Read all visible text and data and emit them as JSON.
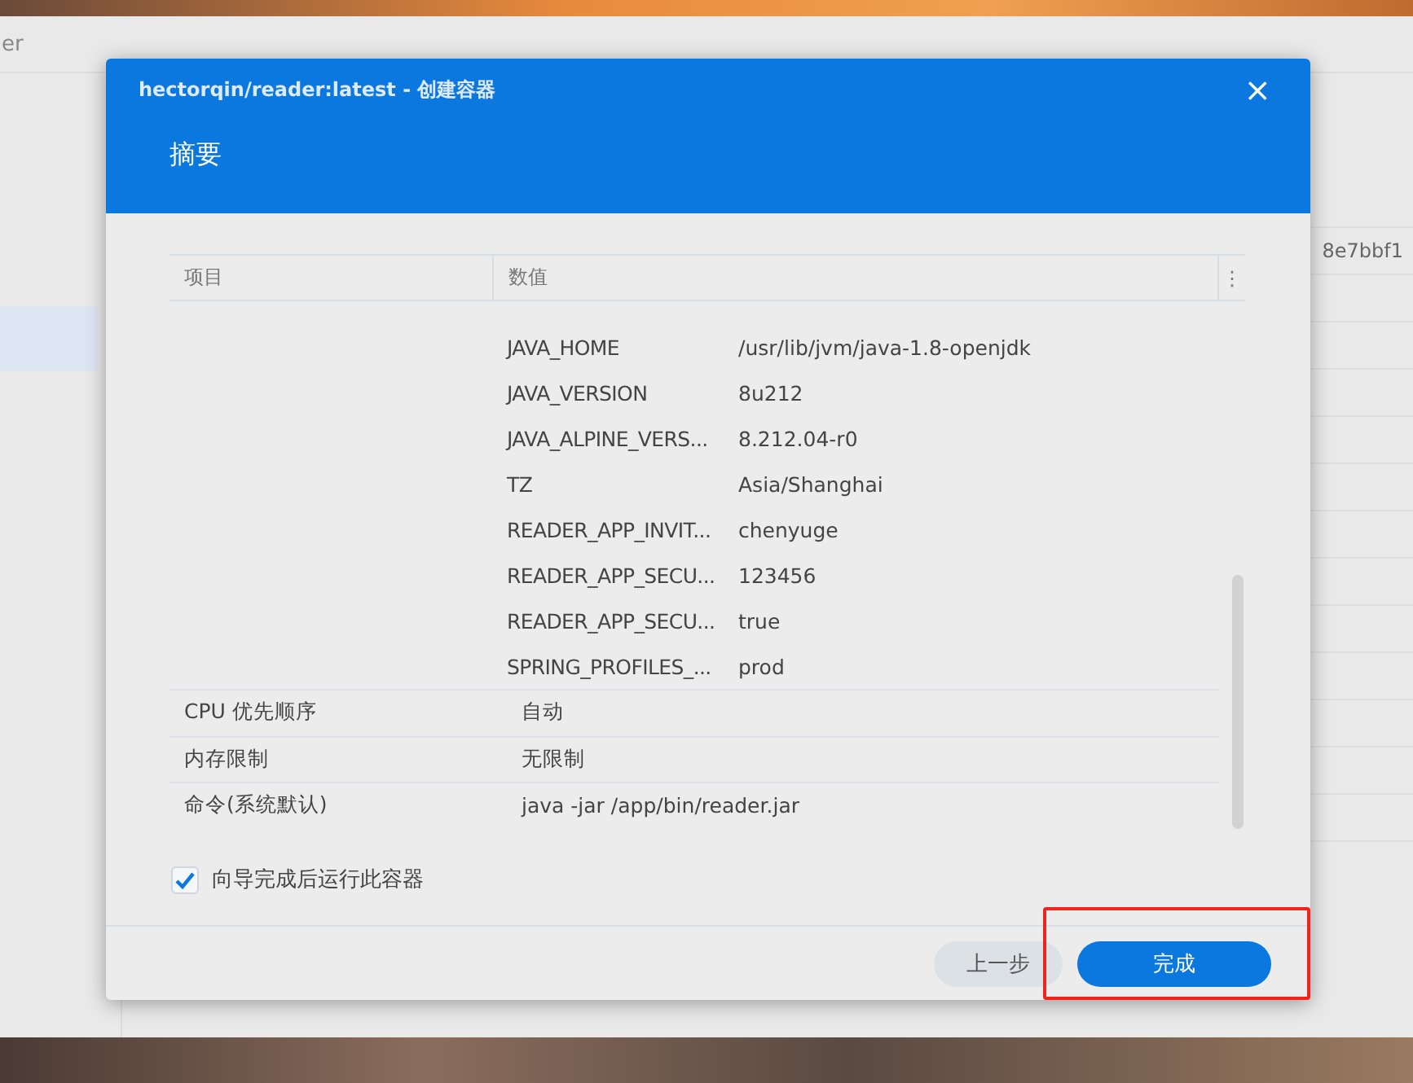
{
  "background_app": {
    "title": "er",
    "row_text": "8e7bbf1"
  },
  "dialog": {
    "title": "hectorqin/reader:latest - 创建容器",
    "close": "×",
    "heading": "摘要"
  },
  "table": {
    "columns": [
      "项目",
      "数值"
    ],
    "menu": "⋮",
    "environment": [
      {
        "name": "JAVA_HOME",
        "value": "/usr/lib/jvm/java-1.8-openjdk"
      },
      {
        "name": "JAVA_VERSION",
        "value": "8u212"
      },
      {
        "name": "JAVA_ALPINE_VERS...",
        "value": "8.212.04-r0"
      },
      {
        "name": "TZ",
        "value": "Asia/Shanghai"
      },
      {
        "name": "READER_APP_INVIT...",
        "value": "chenyuge"
      },
      {
        "name": "READER_APP_SECU...",
        "value": "123456"
      },
      {
        "name": "READER_APP_SECU...",
        "value": "true"
      },
      {
        "name": "SPRING_PROFILES_...",
        "value": "prod"
      }
    ],
    "rows": [
      {
        "item": "CPU 优先顺序",
        "value": "自动"
      },
      {
        "item": "内存限制",
        "value": "无限制"
      },
      {
        "item": "命令(系统默认)",
        "value": "java -jar /app/bin/reader.jar"
      }
    ]
  },
  "run_after": {
    "label": "向导完成后运行此容器",
    "checked": true
  },
  "buttons": [
    {
      "label": "上一步",
      "kind": "secondary"
    },
    {
      "label": "完成",
      "kind": "primary"
    }
  ]
}
